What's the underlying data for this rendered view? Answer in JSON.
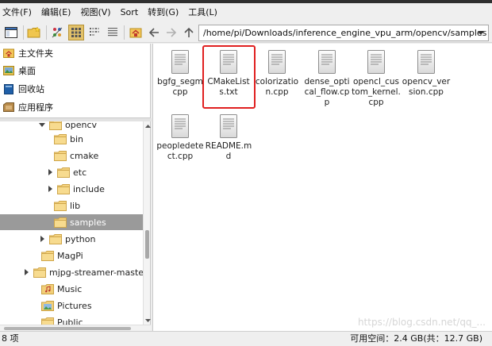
{
  "menu": [
    {
      "key": "file",
      "label": "文件(F)"
    },
    {
      "key": "edit",
      "label": "编辑(E)"
    },
    {
      "key": "view",
      "label": "视图(V)"
    },
    {
      "key": "sort",
      "label": "Sort"
    },
    {
      "key": "go",
      "label": "转到(G)"
    },
    {
      "key": "tools",
      "label": "工具(L)"
    }
  ],
  "toolbar": {
    "path": "/home/pi/Downloads/inference_engine_vpu_arm/opencv/samples",
    "icons": [
      "new-window-icon",
      "new-folder-icon",
      "show-hidden-icon",
      "icon-view-icon",
      "list-view-icon",
      "detail-view-icon",
      "home-icon",
      "back-arrow-icon",
      "forward-arrow-icon",
      "up-arrow-icon"
    ]
  },
  "places": [
    {
      "label": "主文件夹",
      "icon": "home-folder-icon"
    },
    {
      "label": "桌面",
      "icon": "desktop-icon"
    },
    {
      "label": "回收站",
      "icon": "trash-icon"
    },
    {
      "label": "应用程序",
      "icon": "applications-icon"
    }
  ],
  "tree": [
    {
      "label": "opencv",
      "expander": "down"
    },
    {
      "label": "bin",
      "expander": ""
    },
    {
      "label": "cmake",
      "expander": ""
    },
    {
      "label": "etc",
      "expander": "right"
    },
    {
      "label": "include",
      "expander": "right"
    },
    {
      "label": "lib",
      "expander": ""
    },
    {
      "label": "samples",
      "expander": "",
      "selected": true
    },
    {
      "label": "python",
      "expander": "right"
    },
    {
      "label": "MagPi",
      "expander": ""
    },
    {
      "label": "mjpg-streamer-master",
      "expander": "right"
    },
    {
      "label": "Music",
      "expander": "",
      "icon": "music"
    },
    {
      "label": "Pictures",
      "expander": "",
      "icon": "pictures"
    },
    {
      "label": "Public",
      "expander": ""
    }
  ],
  "files": [
    {
      "name": "bgfg_segm.cpp",
      "label": "bgfg_segmcpp"
    },
    {
      "name": "CMakeLists.txt",
      "label": "CMakeLists.txt",
      "highlighted": true
    },
    {
      "name": "colorization.cpp",
      "label": "colorization.cpp"
    },
    {
      "name": "dense_optical_flow.cpp",
      "label": "dense_optical_flow.cpp"
    },
    {
      "name": "opencl_custom_kernel.cpp",
      "label": "opencl_custom_kernel.cpp"
    },
    {
      "name": "opencv_version.cpp",
      "label": "opencv_version.cpp"
    },
    {
      "name": "peopledetect.cpp",
      "label": "peopledetect.cpp"
    },
    {
      "name": "README.md",
      "label": "README.md"
    }
  ],
  "status": {
    "count": "8 项",
    "free_space": "可用空间：2.4 GB(共：12.7 GB)"
  },
  "watermark": "https://blog.csdn.net/qq_..."
}
